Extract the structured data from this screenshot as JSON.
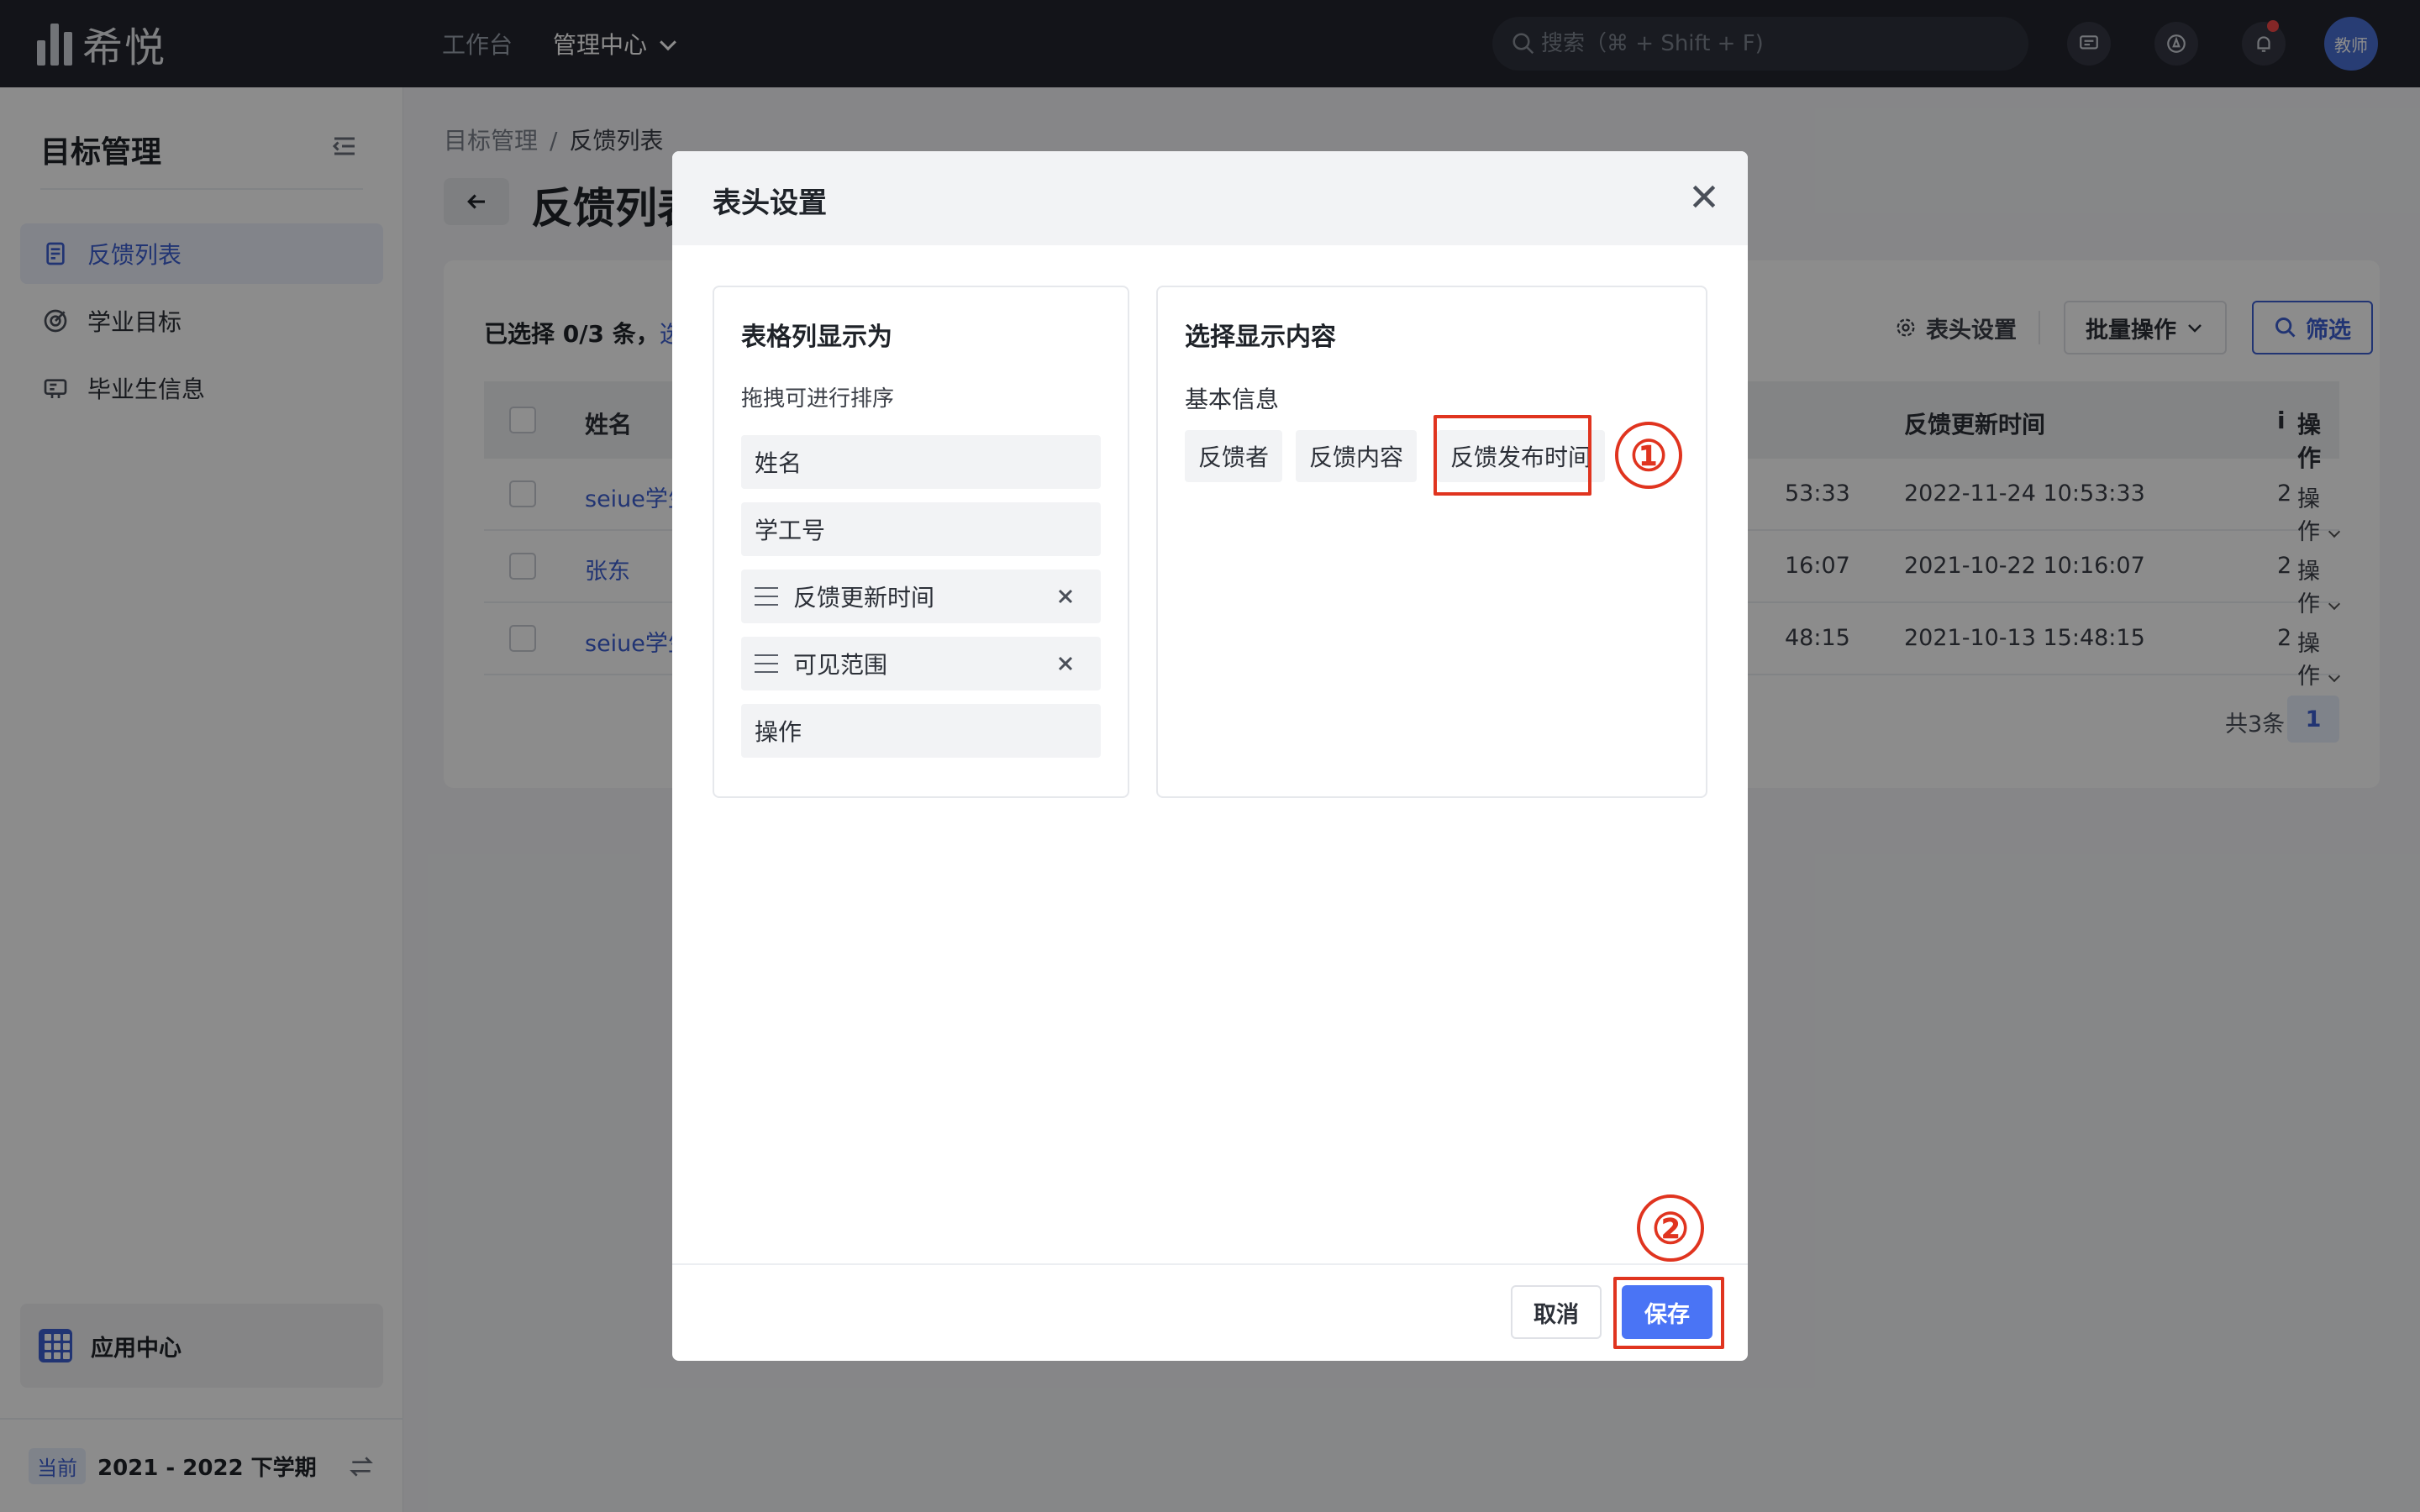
{
  "topbar": {
    "logo_text": "希悦",
    "nav": [
      {
        "label": "工作台"
      },
      {
        "label": "管理中心"
      }
    ],
    "search_placeholder": "搜索（⌘ + Shift + F)",
    "avatar_text": "教师",
    "icons": [
      "chat-icon",
      "compass-icon",
      "bell-icon"
    ]
  },
  "sidebar": {
    "title": "目标管理",
    "items": [
      {
        "label": "反馈列表",
        "icon": "document-list-icon",
        "active": true
      },
      {
        "label": "学业目标",
        "icon": "target-icon",
        "active": false
      },
      {
        "label": "毕业生信息",
        "icon": "id-card-icon",
        "active": false
      }
    ],
    "app_center": "应用中心",
    "term": {
      "tag": "当前",
      "text": "2021 - 2022 下学期"
    }
  },
  "main": {
    "breadcrumb": [
      "目标管理",
      "/",
      "反馈列表"
    ],
    "page_title": "反馈列表",
    "selection": {
      "text": "已选择 0/3 条，",
      "link": "选"
    },
    "toolbar": {
      "settings": "表头设置",
      "batch": "批量操作",
      "filter": "筛选"
    },
    "table": {
      "headers": {
        "name": "姓名",
        "updated": "反馈更新时间",
        "partial": "i",
        "op": "操作"
      },
      "rows": [
        {
          "name": "seiue学生",
          "published_tail": "53:33",
          "updated": "2022-11-24 10:53:33",
          "partial": "2",
          "op": "操作"
        },
        {
          "name": "张东",
          "published_tail": "16:07",
          "updated": "2021-10-22 10:16:07",
          "partial": "2",
          "op": "操作"
        },
        {
          "name": "seiue学生",
          "published_tail": "48:15",
          "updated": "2021-10-13 15:48:15",
          "partial": "2",
          "op": "操作"
        }
      ]
    },
    "total": "共3条",
    "page": "1"
  },
  "modal": {
    "title": "表头设置",
    "left": {
      "title": "表格列显示为",
      "subtitle": "拖拽可进行排序",
      "columns": [
        {
          "label": "姓名",
          "draggable": false,
          "removable": false
        },
        {
          "label": "学工号",
          "draggable": false,
          "removable": false
        },
        {
          "label": "反馈更新时间",
          "draggable": true,
          "removable": true
        },
        {
          "label": "可见范围",
          "draggable": true,
          "removable": true
        },
        {
          "label": "操作",
          "draggable": false,
          "removable": false
        }
      ]
    },
    "right": {
      "title": "选择显示内容",
      "group": "基本信息",
      "chips": [
        "反馈者",
        "反馈内容",
        "反馈发布时间"
      ]
    },
    "annotations": [
      "①",
      "②"
    ],
    "cancel": "取消",
    "save": "保存",
    "accent": "#4a74f5",
    "highlight": "#e0341f"
  }
}
